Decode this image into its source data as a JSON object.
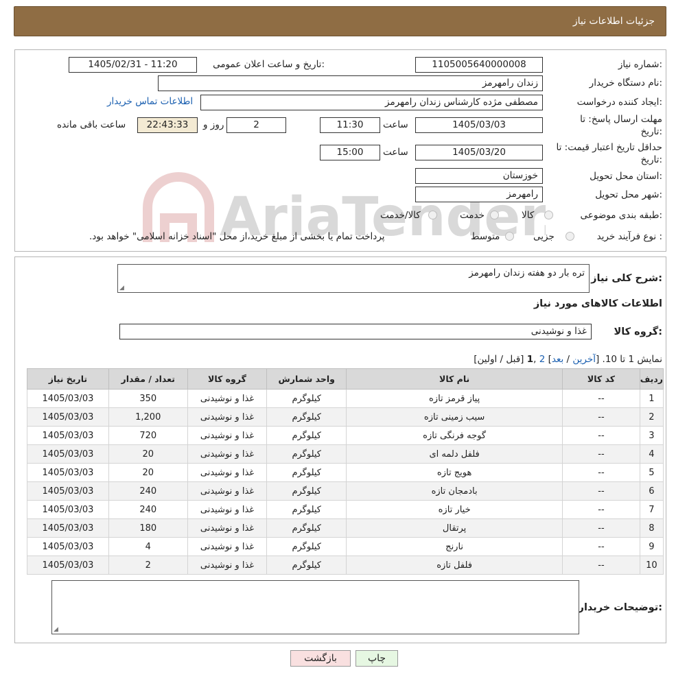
{
  "header": {
    "title": "جزئيات اطلاعات نیاز"
  },
  "form": {
    "need_number_label": "شماره نیاز:",
    "need_number": "1105005640000008",
    "announce_label": "تاریخ و ساعت اعلان عمومی:",
    "announce_value": "1405/02/31 - 11:20",
    "buyer_org_label": "نام دستگاه خریدار:",
    "buyer_org": "زندان رامهرمز",
    "creator_label": "ایجاد کننده درخواست:",
    "creator": "مصطفی مژده کارشناس زندان رامهرمز",
    "contact_link": "اطلاعات تماس خریدار",
    "deadline_label": "مهلت ارسال پاسخ: تا تاریخ:",
    "deadline_date": "1405/03/03",
    "time_label": "ساعت",
    "deadline_time": "11:30",
    "days_value": "2",
    "days_label": "روز و",
    "remaining_time": "22:43:33",
    "remaining_label": "ساعت باقی مانده",
    "validity_label": "حداقل تاریخ اعتبار قیمت: تا تاریخ:",
    "validity_date": "1405/03/20",
    "validity_time": "15:00",
    "province_label": "استان محل تحویل:",
    "province": "خوزستان",
    "city_label": "شهر محل تحویل:",
    "city": "رامهرمز",
    "category_label": "طبقه بندی موضوعی:",
    "category_options": [
      "کالا",
      "خدمت",
      "کالا/خدمت"
    ],
    "process_label": "نوع فرآیند خرید :",
    "process_options": [
      "جزیی",
      "متوسط"
    ],
    "process_note": "پرداخت تمام یا بخشی از مبلغ خرید،از محل \"اسناد خزانه اسلامی\" خواهد بود."
  },
  "details": {
    "description_label": "شرح کلی نیاز:",
    "description": "تره بار دو هفته زندان رامهرمز",
    "goods_info_title": "اطلاعات کالاهای مورد نیاز",
    "goods_group_label": "گروه کالا:",
    "goods_group": "غذا و نوشیدنی",
    "pager_text": "نمایش 1 تا 10. [",
    "pager_last": "آخرین",
    "pager_sep1": " / ",
    "pager_next": "بعد",
    "pager_close": "] ",
    "pager_page2": "2",
    "pager_comma": " ,",
    "pager_current": "1",
    "pager_tail": " [قبل / اولین]",
    "buyer_notes_label": "توضیحات خریدار:"
  },
  "table": {
    "headers": [
      "ردیف",
      "کد کالا",
      "نام کالا",
      "واحد شمارش",
      "گروه کالا",
      "تعداد / مقدار",
      "تاریخ نیاز"
    ],
    "rows": [
      [
        "1",
        "--",
        "پیاز قرمز تازه",
        "کیلوگرم",
        "غذا و نوشیدنی",
        "350",
        "1405/03/03"
      ],
      [
        "2",
        "--",
        "سیب زمینی تازه",
        "کیلوگرم",
        "غذا و نوشیدنی",
        "1,200",
        "1405/03/03"
      ],
      [
        "3",
        "--",
        "گوجه فرنگی تازه",
        "کیلوگرم",
        "غذا و نوشیدنی",
        "720",
        "1405/03/03"
      ],
      [
        "4",
        "--",
        "فلفل دلمه ای",
        "کیلوگرم",
        "غذا و نوشیدنی",
        "20",
        "1405/03/03"
      ],
      [
        "5",
        "--",
        "هویج تازه",
        "کیلوگرم",
        "غذا و نوشیدنی",
        "20",
        "1405/03/03"
      ],
      [
        "6",
        "--",
        "بادمجان تازه",
        "کیلوگرم",
        "غذا و نوشیدنی",
        "240",
        "1405/03/03"
      ],
      [
        "7",
        "--",
        "خیار تازه",
        "کیلوگرم",
        "غذا و نوشیدنی",
        "240",
        "1405/03/03"
      ],
      [
        "8",
        "--",
        "پرتقال",
        "کیلوگرم",
        "غذا و نوشیدنی",
        "180",
        "1405/03/03"
      ],
      [
        "9",
        "--",
        "نارنج",
        "کیلوگرم",
        "غذا و نوشیدنی",
        "4",
        "1405/03/03"
      ],
      [
        "10",
        "--",
        "فلفل تازه",
        "کیلوگرم",
        "غذا و نوشیدنی",
        "2",
        "1405/03/03"
      ]
    ]
  },
  "buttons": {
    "back": "بازگشت",
    "print": "چاپ"
  },
  "watermark": {
    "text": "AriaTender.neT"
  }
}
